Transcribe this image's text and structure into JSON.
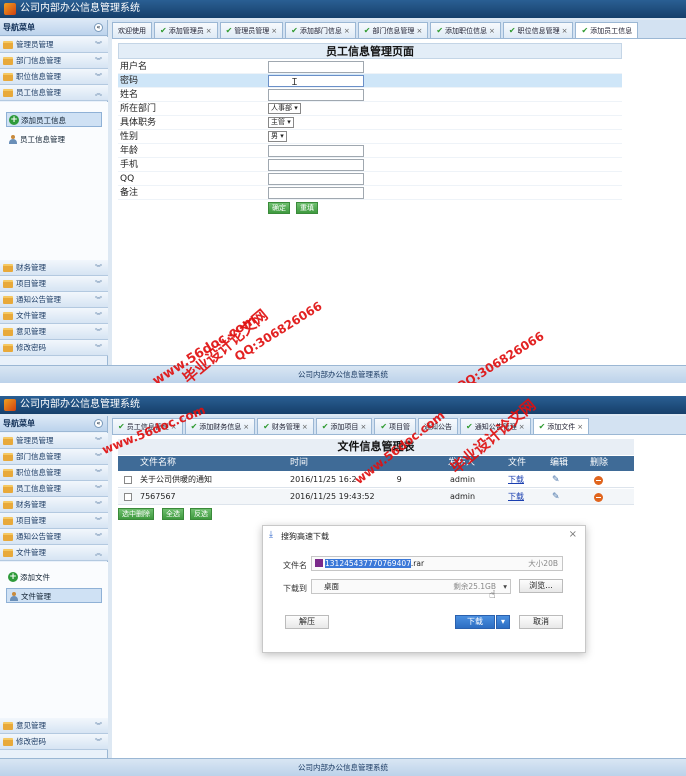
{
  "app_title": "公司内部办公信息管理系统",
  "footer_text": "公司内部办公信息管理系统",
  "nav_header": "导航菜单",
  "collapse_glyph": "«",
  "screen1": {
    "nav_top": [
      "管理员管理",
      "部门信息管理",
      "职位信息管理"
    ],
    "nav_open": "员工信息管理",
    "sub_items": [
      "添加员工信息",
      "员工信息管理"
    ],
    "nav_bottom": [
      "财务管理",
      "项目管理",
      "通知公告管理",
      "文件管理",
      "意见管理",
      "修改密码"
    ],
    "tabs": [
      "欢迎使用",
      "添加管理员",
      "管理员管理",
      "添加部门信息",
      "部门信息管理",
      "添加职位信息",
      "职位信息管理",
      "添加员工信息"
    ],
    "form": {
      "title": "员工信息管理页面",
      "labels": [
        "用户名",
        "密码",
        "姓名",
        "所在部门",
        "具体职务",
        "性别",
        "年龄",
        "手机",
        "QQ",
        "备注"
      ],
      "department": "人事部",
      "position": "主管",
      "gender": "男",
      "submit": "确定",
      "reset": "重填"
    }
  },
  "screen2": {
    "nav_top": [
      "管理员管理",
      "部门信息管理",
      "职位信息管理",
      "员工信息管理",
      "财务管理",
      "项目管理",
      "通知公告管理"
    ],
    "nav_open": "文件管理",
    "sub_items": [
      "添加文件",
      "文件管理"
    ],
    "nav_bottom": [
      "意见管理",
      "修改密码"
    ],
    "tabs": [
      "员工信息管理",
      "添加财务信息",
      "财务管理",
      "添加项目",
      "项目管",
      "通知公告",
      "通知公告管理",
      "添加文件"
    ],
    "table": {
      "title": "文件信息管理",
      "title_tail": "表",
      "headers": [
        "文件名称",
        "时间",
        "发布人",
        "文件",
        "编辑",
        "删除"
      ],
      "rows": [
        {
          "name": "关于公司供暖的通知",
          "time": "2016/11/25 16:2",
          "time_tail": "9",
          "publisher": "admin",
          "file": "下载"
        },
        {
          "name": "7567567",
          "time": "2016/11/25 19:43:52",
          "publisher": "admin",
          "file": "下载"
        }
      ],
      "actions": [
        "选中删除",
        "全选",
        "反选"
      ]
    },
    "dialog": {
      "title": "搜狗高速下载",
      "close": "×",
      "filename_label": "文件名",
      "filename_selected": "131245437770769407",
      "filename_ext": ".rar",
      "size": "大小20B",
      "saveto_label": "下载到",
      "saveto_value": "桌面",
      "remaining": "剩余25.1GB",
      "browse": "浏览...",
      "extract": "解压",
      "download": "下载",
      "cancel": "取消"
    }
  },
  "watermarks": [
    "毕业设计论文网",
    "QQ:306826066",
    "www.56doc.com"
  ]
}
